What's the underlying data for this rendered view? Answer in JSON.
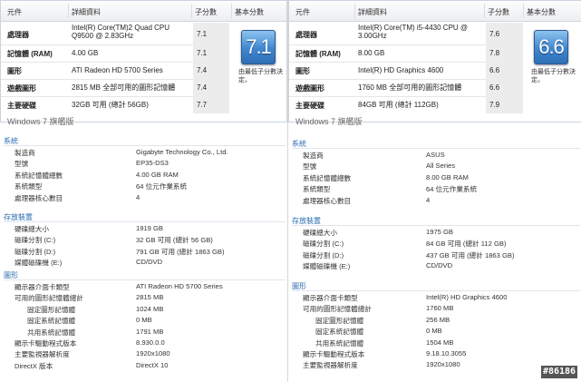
{
  "left": {
    "headers": {
      "component": "元件",
      "detail": "詳細資料",
      "subscore": "子分數",
      "basescore": "基本分數"
    },
    "rows": [
      {
        "label": "處理器",
        "detail": "Intel(R) Core(TM)2 Quad CPU",
        "detail2": "Q9500 @ 2.83GHz",
        "score": "7.1"
      },
      {
        "label": "記憶體 (RAM)",
        "detail": "4.00 GB",
        "detail2": "",
        "score": "7.1"
      },
      {
        "label": "圖形",
        "detail": "ATI Radeon HD 5700 Series",
        "detail2": "",
        "score": "7.4"
      },
      {
        "label": "遊戲圖形",
        "detail": "2815 MB 全部可用的圖形記憶體",
        "detail2": "",
        "score": "7.4"
      },
      {
        "label": "主要硬碟",
        "detail": "32GB 可用 (總計 56GB)",
        "detail2": "",
        "score": "7.7"
      }
    ],
    "base_score": "7.1",
    "base_caption": "由最低子分數決定。",
    "edition": "Windows 7 旗艦版",
    "sections": [
      {
        "title": "系統",
        "items": [
          {
            "k": "製造商",
            "v": "Gigabyte Technology Co., Ltd.",
            "indent": 1
          },
          {
            "k": "型號",
            "v": "EP35-DS3",
            "indent": 1
          },
          {
            "k": "系統記憶體總數",
            "v": "4.00 GB RAM",
            "indent": 1
          },
          {
            "k": "系統類型",
            "v": "64 位元作業系統",
            "indent": 1
          },
          {
            "k": "處理器核心數目",
            "v": "4",
            "indent": 1
          }
        ]
      },
      {
        "title": "存放裝置",
        "items": [
          {
            "k": "硬碟總大小",
            "v": "1919 GB",
            "indent": 1
          },
          {
            "k": "磁碟分割 (C:)",
            "v": "32 GB 可用 (總計 56 GB)",
            "indent": 1
          },
          {
            "k": "磁碟分割 (D:)",
            "v": "791 GB 可用 (總計 1863 GB)",
            "indent": 1
          },
          {
            "k": "媒體磁碟機 (E:)",
            "v": "CD/DVD",
            "indent": 1
          }
        ]
      },
      {
        "title": "圖形",
        "items": [
          {
            "k": "顯示器介面卡類型",
            "v": "ATI Radeon HD 5700 Series",
            "indent": 1
          },
          {
            "k": "可用的圖形記憶體總計",
            "v": "2815 MB",
            "indent": 1
          },
          {
            "k": "固定圖形記憶體",
            "v": "1024 MB",
            "indent": 2
          },
          {
            "k": "固定系統記憶體",
            "v": "0 MB",
            "indent": 2
          },
          {
            "k": "共用系統記憶體",
            "v": "1791 MB",
            "indent": 2
          },
          {
            "k": "顯示卡驅動程式版本",
            "v": "8.930.0.0",
            "indent": 1
          },
          {
            "k": "主要監視器解析度",
            "v": "1920x1080",
            "indent": 1
          },
          {
            "k": "DirectX 版本",
            "v": "DirectX 10",
            "indent": 1
          }
        ]
      }
    ]
  },
  "right": {
    "headers": {
      "component": "元件",
      "detail": "詳細資料",
      "subscore": "子分數",
      "basescore": "基本分數"
    },
    "rows": [
      {
        "label": "處理器",
        "detail": "Intel(R) Core(TM) i5-4430 CPU @",
        "detail2": "3.00GHz",
        "score": "7.6"
      },
      {
        "label": "記憶體 (RAM)",
        "detail": "8.00 GB",
        "detail2": "",
        "score": "7.8"
      },
      {
        "label": "圖形",
        "detail": "Intel(R) HD Graphics 4600",
        "detail2": "",
        "score": "6.6"
      },
      {
        "label": "遊戲圖形",
        "detail": "1760 MB 全部可用的圖形記憶體",
        "detail2": "",
        "score": "6.6"
      },
      {
        "label": "主要硬碟",
        "detail": "84GB 可用 (總計 112GB)",
        "detail2": "",
        "score": "7.9"
      }
    ],
    "base_score": "6.6",
    "base_caption": "由最低子分數決定。",
    "edition": "Windows 7 旗艦版",
    "sections": [
      {
        "title": "系統",
        "items": [
          {
            "k": "製造商",
            "v": "ASUS",
            "indent": 1
          },
          {
            "k": "型號",
            "v": "All Series",
            "indent": 1
          },
          {
            "k": "系統記憶體總數",
            "v": "8.00 GB RAM",
            "indent": 1
          },
          {
            "k": "系統類型",
            "v": "64 位元作業系統",
            "indent": 1
          },
          {
            "k": "處理器核心數目",
            "v": "4",
            "indent": 1
          }
        ]
      },
      {
        "title": "存放裝置",
        "items": [
          {
            "k": "硬碟總大小",
            "v": "1975 GB",
            "indent": 1
          },
          {
            "k": "磁碟分割 (C:)",
            "v": "84 GB 可用 (總計 112 GB)",
            "indent": 1
          },
          {
            "k": "磁碟分割 (D:)",
            "v": "437 GB 可用 (總計 1863 GB)",
            "indent": 1
          },
          {
            "k": "媒體磁碟機 (E:)",
            "v": "CD/DVD",
            "indent": 1
          }
        ]
      },
      {
        "title": "圖形",
        "items": [
          {
            "k": "顯示器介面卡類型",
            "v": "Intel(R) HD Graphics 4600",
            "indent": 1
          },
          {
            "k": "可用的圖形記憶體總計",
            "v": "1760 MB",
            "indent": 1
          },
          {
            "k": "固定圖形記憶體",
            "v": "256 MB",
            "indent": 2
          },
          {
            "k": "固定系統記憶體",
            "v": "0 MB",
            "indent": 2
          },
          {
            "k": "共用系統記憶體",
            "v": "1504 MB",
            "indent": 2
          },
          {
            "k": "顯示卡驅動程式版本",
            "v": "9.18.10.3055",
            "indent": 1
          },
          {
            "k": "主要監視器解析度",
            "v": "1920x1080",
            "indent": 1
          }
        ]
      }
    ]
  },
  "watermark": "#86186"
}
